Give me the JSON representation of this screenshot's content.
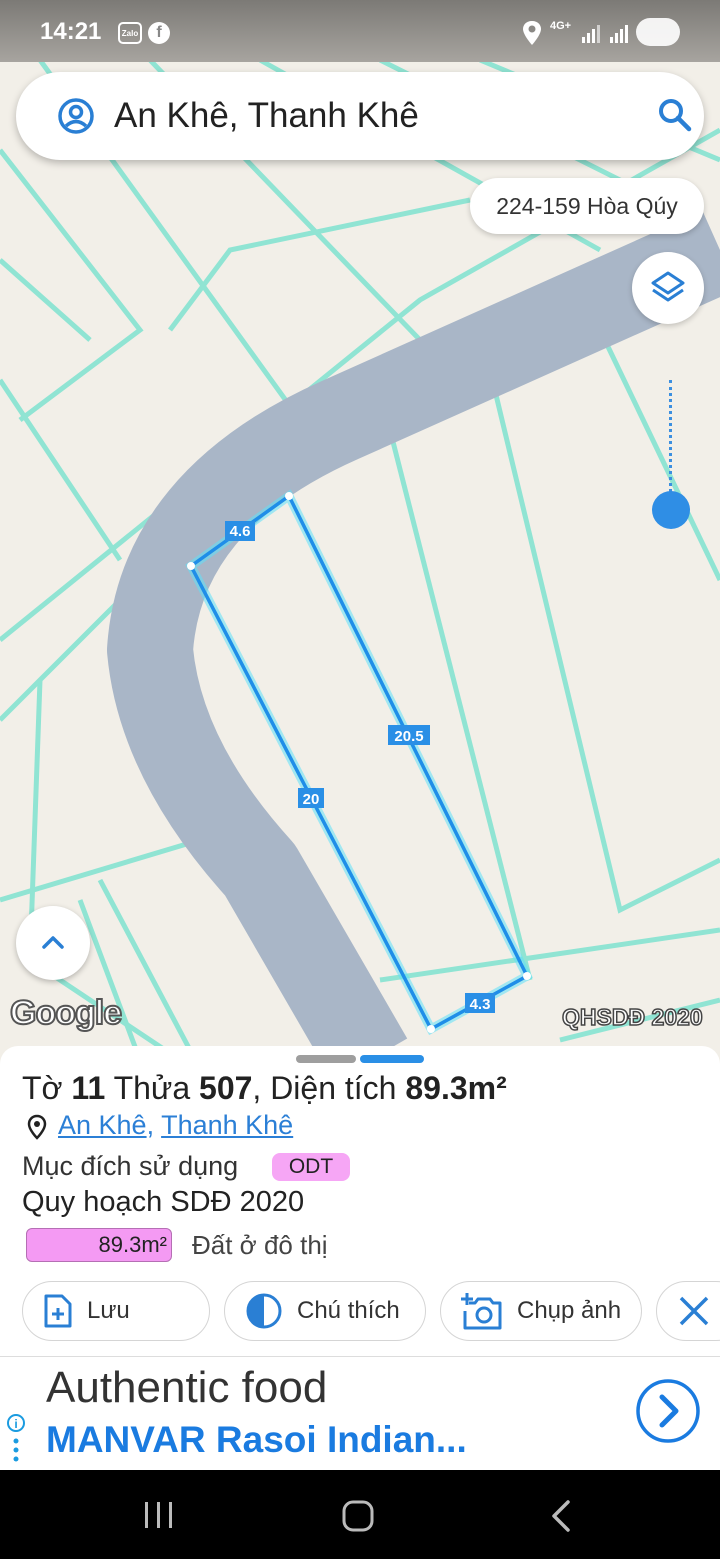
{
  "status_bar": {
    "time": "14:21",
    "app1": "Zalo",
    "app2": "f",
    "network": "4G+"
  },
  "search": {
    "text": "An Khê, Thanh Khê"
  },
  "address_chip": "224-159 Hòa Qúy",
  "map": {
    "edge_labels": [
      "4.6",
      "20.5",
      "20",
      "4.3"
    ],
    "attribution": "Google",
    "layer_label": "QHSDĐ 2020"
  },
  "parcel": {
    "sheet_prefix": "Tờ",
    "sheet_no": "11",
    "parcel_prefix": "Thửa",
    "parcel_no": "507",
    "area_prefix": ", Diện tích",
    "area": "89.3m²",
    "ward": "An Khê",
    "district": "Thanh Khê",
    "purpose_label": "Mục đích sử dụng",
    "purpose_code": "ODT",
    "plan_label": "Quy hoạch SDĐ 2020",
    "plan_area": "89.3m²",
    "plan_type": "Đất ở đô thị",
    "colors": {
      "odt": "#f6a6f5",
      "link": "#2b7fd6",
      "accent": "#2a8fe6"
    }
  },
  "actions": {
    "save": "Lưu",
    "legend": "Chú thích",
    "photo": "Chụp ảnh"
  },
  "ad": {
    "title": "Authentic food",
    "subtitle": "MANVAR Rasoi Indian..."
  }
}
